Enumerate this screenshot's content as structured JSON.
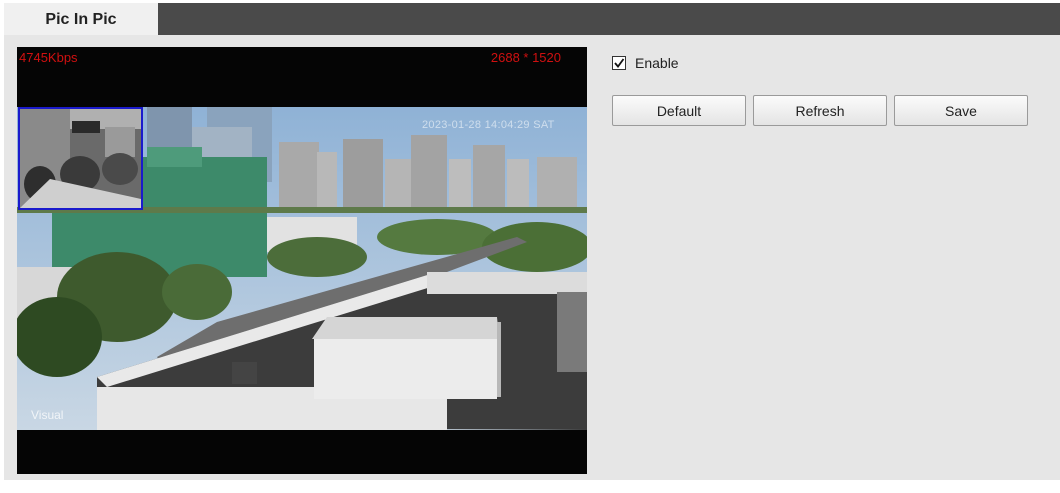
{
  "tabs": [
    {
      "label": "Pic In Pic",
      "active": true
    }
  ],
  "video": {
    "bitrate": "4745Kbps",
    "resolution": "2688 * 1520",
    "timestamp": "2023-01-28 14:04:29 SAT",
    "channel_label": "Visual",
    "overlay_text_color": "#d01010",
    "pip_border_color": "#1a1acc"
  },
  "controls": {
    "enable_label": "Enable",
    "enable_checked": true
  },
  "buttons": {
    "default_label": "Default",
    "refresh_label": "Refresh",
    "save_label": "Save"
  }
}
